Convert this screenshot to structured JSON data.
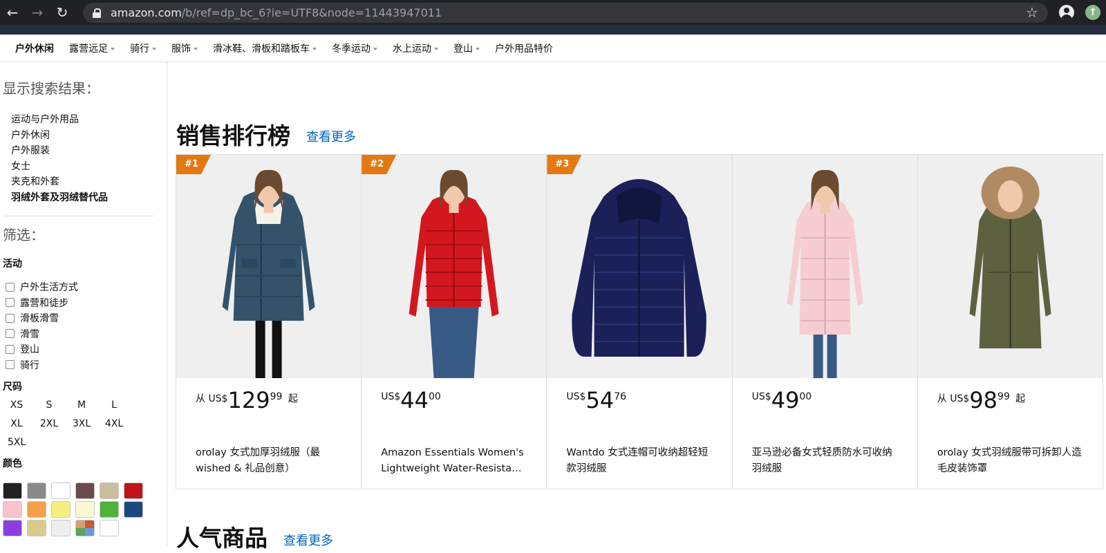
{
  "browser": {
    "host": "amazon.com",
    "path": "/b/ref=dp_bc_6?ie=UTF8&node=11443947011"
  },
  "catnav": [
    {
      "label": "户外休闲",
      "caret": false,
      "bold": true
    },
    {
      "label": "露营远足",
      "caret": true
    },
    {
      "label": "骑行",
      "caret": true
    },
    {
      "label": "服饰",
      "caret": true
    },
    {
      "label": "滑冰鞋、滑板和踏板车",
      "caret": true
    },
    {
      "label": "冬季运动",
      "caret": true
    },
    {
      "label": "水上运动",
      "caret": true
    },
    {
      "label": "登山",
      "caret": true
    },
    {
      "label": "户外用品特价",
      "caret": false
    }
  ],
  "sidebar": {
    "results_heading": "显示搜索结果：",
    "departments": [
      "运动与户外用品",
      "户外休闲",
      "户外服装",
      "女士",
      "夹克和外套",
      "羽绒外套及羽绒替代品"
    ],
    "filter_heading": "筛选：",
    "activity_heading": "活动",
    "activities": [
      "户外生活方式",
      "露营和徒步",
      "滑板滑雪",
      "滑雪",
      "登山",
      "骑行"
    ],
    "size_heading": "尺码",
    "sizes": [
      "XS",
      "S",
      "M",
      "L",
      "XL",
      "2XL",
      "3XL",
      "4XL",
      "5XL"
    ],
    "color_heading": "颜色",
    "colors": [
      "#222222",
      "#8a8a8a",
      "#ffffff",
      "#6b4a4e",
      "#c9bfa0",
      "#c0141b",
      "#f7c3cc",
      "#f5a048",
      "#f5ef7e",
      "#fbf8d6",
      "#4fb23a",
      "#1d477f",
      "#8b3fe0",
      "#d8cc8c",
      "#eeeeee",
      "multi",
      "#ffffff"
    ]
  },
  "main": {
    "best_sellers_heading": "销售排行榜",
    "see_more": "查看更多",
    "popular_heading": "人气商品",
    "see_more_2": "查看更多"
  },
  "products": [
    {
      "rank": "#1",
      "prefix": "从 US$",
      "whole": "129",
      "frac": "99",
      "suffix": "起",
      "title": "orolay 女式加厚羽绒服（最 wished & 礼品创意）",
      "color": "#34536b",
      "style": "parka"
    },
    {
      "rank": "#2",
      "prefix": "US$",
      "whole": "44",
      "frac": "00",
      "suffix": "",
      "title": "Amazon Essentials Women's Lightweight Water-Resista…",
      "color": "#d4171e",
      "style": "puffer"
    },
    {
      "rank": "#3",
      "prefix": "US$",
      "whole": "54",
      "frac": "76",
      "suffix": "",
      "title": "Wantdo 女式连帽可收纳超轻短款羽绒服",
      "color": "#1b2059",
      "style": "flat"
    },
    {
      "rank": "",
      "prefix": "US$",
      "whole": "49",
      "frac": "00",
      "suffix": "",
      "title": "亚马逊必备女式轻质防水可收纳羽绒服",
      "color": "#f6cdd2",
      "style": "long"
    },
    {
      "rank": "",
      "prefix": "从 US$",
      "whole": "98",
      "frac": "99",
      "suffix": "起",
      "title": "orolay 女式羽绒服带可拆卸人造毛皮装饰罩",
      "color": "#5d6140",
      "style": "fur"
    }
  ]
}
